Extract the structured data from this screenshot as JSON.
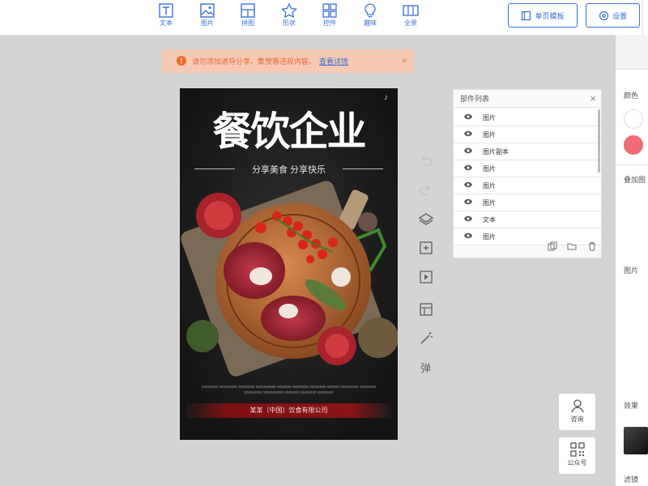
{
  "toolbar": {
    "items": [
      {
        "label": "文本",
        "icon": "text-icon"
      },
      {
        "label": "图片",
        "icon": "image-icon"
      },
      {
        "label": "拼图",
        "icon": "collage-icon"
      },
      {
        "label": "形状",
        "icon": "star-icon"
      },
      {
        "label": "控件",
        "icon": "widget-icon"
      },
      {
        "label": "趣味",
        "icon": "bulb-icon"
      },
      {
        "label": "全景",
        "icon": "panorama-icon"
      }
    ],
    "single_page_template_label": "单页模板",
    "settings_label": "设置"
  },
  "notice": {
    "text": "请勿添加诱导分享、集赞等违规内容。",
    "link": "查看详情"
  },
  "poster": {
    "title": "餐饮企业",
    "subtitle": "分享美食 分享快乐",
    "small_text": "xxxxxxxx xxxxxxxxx xxxxxxxx xxxxxxxxxx xxxxxxx xxxxxxxx xxxxxxxx xxxxxx xxxxxxxxx xxxxxxxx xxxxxxxxx xxxxxxxxxx xxxxxxx xxxxxxxx xxxxxxxx",
    "company": "某某（中国）饮食有限公司"
  },
  "layer_panel": {
    "title": "部件列表",
    "layers": [
      "图片",
      "图片",
      "图片副本",
      "图片",
      "图片",
      "图片",
      "文本",
      "图片"
    ]
  },
  "right_panel": {
    "color_label": "颜色",
    "overlay_label": "叠加图",
    "image_label": "图片",
    "effect_label": "效果",
    "filter_label": "滤镜",
    "swatch_white": "#ffffff",
    "swatch_red": "#f06b75"
  },
  "float_buttons": {
    "consult_label": "咨询",
    "official_account_label": "公众号"
  },
  "colors": {
    "accent": "#3b6fd6",
    "notice_bg": "#f6c9b3",
    "notice_text": "#e06a3d"
  }
}
